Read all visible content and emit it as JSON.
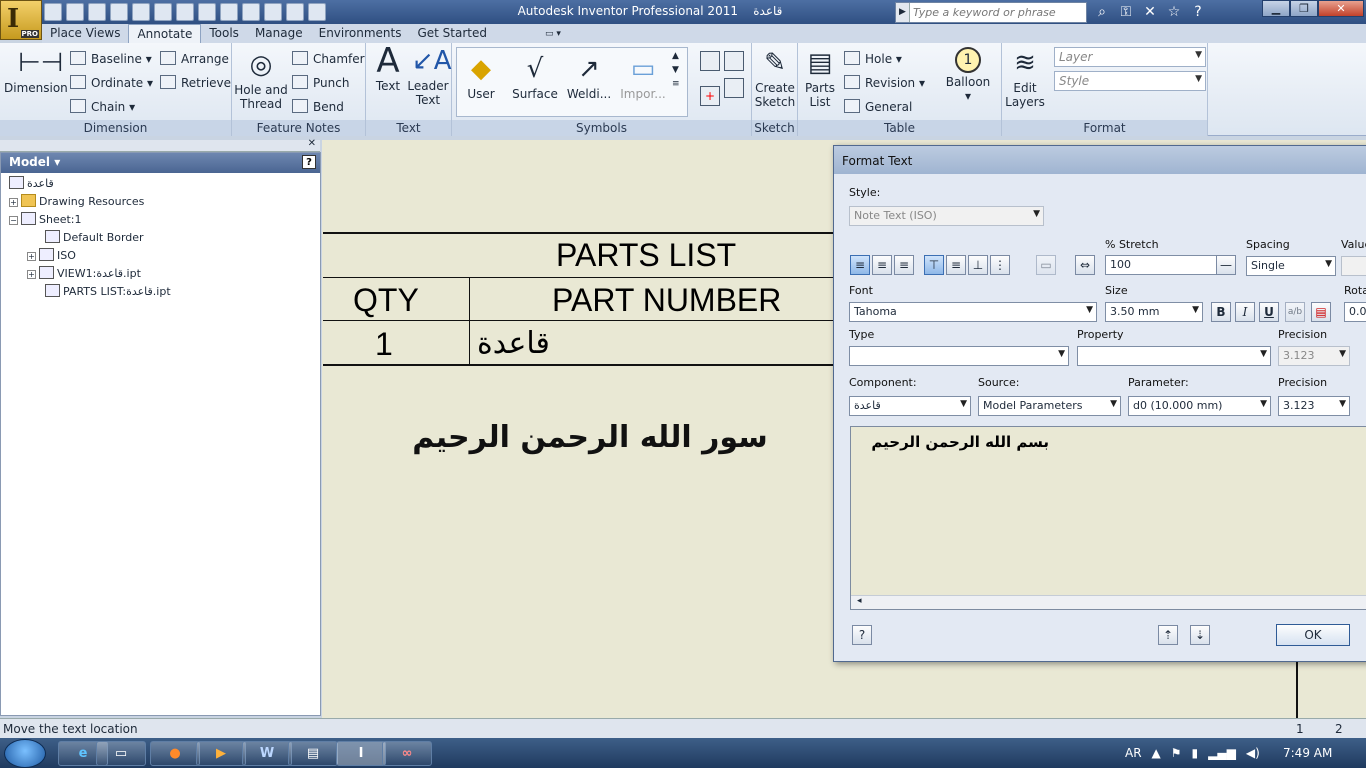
{
  "window": {
    "title": "Autodesk Inventor Professional 2011",
    "document": "قاعدة"
  },
  "app_button": {
    "letter": "I",
    "badge": "PRO"
  },
  "search": {
    "placeholder": "Type a keyword or phrase"
  },
  "ribbon_tabs": [
    "Place Views",
    "Annotate",
    "Tools",
    "Manage",
    "Environments",
    "Get Started"
  ],
  "active_tab": "Annotate",
  "ribbon": {
    "dimension": {
      "title": "Dimension",
      "big": "Dimension",
      "items": [
        "Baseline",
        "Ordinate",
        "Chain",
        "Arrange",
        "Retrieve"
      ]
    },
    "feature_notes": {
      "title": "Feature Notes",
      "big": "Hole and Thread",
      "items": [
        "Chamfer",
        "Punch",
        "Bend"
      ]
    },
    "text": {
      "title": "Text",
      "items": [
        "Text",
        "Leader Text"
      ]
    },
    "symbols": {
      "title": "Symbols",
      "items": [
        "User",
        "Surface",
        "Weldi...",
        "Impor..."
      ]
    },
    "sketch": {
      "title": "Sketch",
      "big": "Create Sketch"
    },
    "table": {
      "title": "Table",
      "big": "Parts List",
      "items": [
        "Hole",
        "Revision",
        "General"
      ]
    },
    "balloon": {
      "label": "Balloon",
      "num": "1"
    },
    "format": {
      "title": "Format",
      "edit_layers": "Edit Layers",
      "layer_placeholder": "Layer",
      "style_placeholder": "Style"
    }
  },
  "browser": {
    "title": "Model",
    "help": "?",
    "tree": [
      {
        "label": "قاعدة"
      },
      {
        "label": "Drawing Resources"
      },
      {
        "label": "Sheet:1"
      },
      {
        "label": "Default Border"
      },
      {
        "label": "ISO"
      },
      {
        "label": "VIEW1:قاعدة.ipt"
      },
      {
        "label": "PARTS LIST:قاعدة.ipt"
      }
    ]
  },
  "canvas": {
    "parts_list": {
      "title": "PARTS LIST",
      "col_qty": "QTY",
      "col_part": "PART NUMBER",
      "row_qty": "1",
      "row_part": "قاعدة"
    },
    "note": "ﺳﻮﺭ اﻟﻠﻪ اﻟﺮﺣﻤﻦ اﻟﺮﺣﻴﻢ"
  },
  "dialog": {
    "title": "Format Text",
    "style_label": "Style:",
    "style_value": "Note Text (ISO)",
    "stretch_label": "% Stretch",
    "stretch_value": "100",
    "spacing_label": "Spacing",
    "spacing_value": "Single",
    "value_label": "Value",
    "font_label": "Font",
    "font_value": "Tahoma",
    "size_label": "Size",
    "size_value": "3.50 mm",
    "rota_label": "Rota",
    "rota_value": "0.0",
    "type_label": "Type",
    "property_label": "Property",
    "precision_label": "Precision",
    "precision1_value": "3.123",
    "component_label": "Component:",
    "component_value": "قاعدة",
    "source_label": "Source:",
    "source_value": "Model Parameters",
    "parameter_label": "Parameter:",
    "parameter_value": "d0 (10.000 mm)",
    "precision2_value": "3.123",
    "text_value": "بسم الله الرحمن الرحيم",
    "ok_label": "OK",
    "bold": "B",
    "italic": "I",
    "underline": "U"
  },
  "status": {
    "message": "Move the text location",
    "page1": "1",
    "page2": "2"
  },
  "taskbar": {
    "lang": "AR",
    "time": "7:49 AM"
  }
}
